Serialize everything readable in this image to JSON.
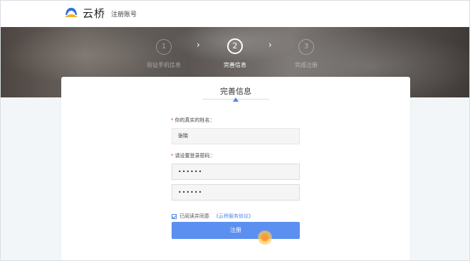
{
  "header": {
    "logo_text": "云桥",
    "subtitle": "注册账号"
  },
  "steps": [
    {
      "number": "1",
      "label": "验证手机信息"
    },
    {
      "number": "2",
      "label": "完善信息"
    },
    {
      "number": "3",
      "label": "完成注册"
    }
  ],
  "step_arrows": [
    "›",
    "›"
  ],
  "form": {
    "title": "完善信息",
    "name_label": "你的真实的姓名：",
    "name_value": "张晓",
    "password_label": "请设置登录密码：",
    "password_value": "••••••",
    "password_confirm_value": "••••••",
    "agree_text": "已阅读并同意",
    "agree_link": "《云桥服务协议》",
    "submit_label": "注册"
  },
  "colors": {
    "accent": "#5b8ff0",
    "link": "#4d88e8",
    "required": "#e53935"
  }
}
